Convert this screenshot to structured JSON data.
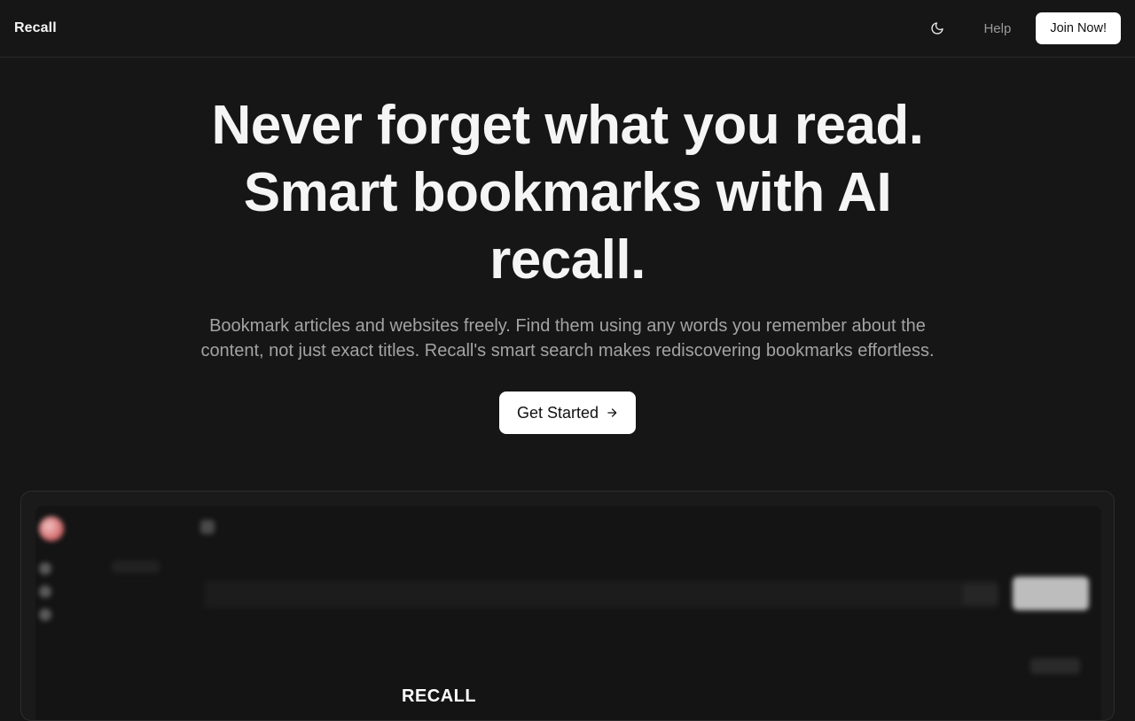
{
  "navbar": {
    "brand": "Recall",
    "theme_toggle_icon": "moon-icon",
    "help_label": "Help",
    "join_label": "Join Now!"
  },
  "hero": {
    "title_lines": [
      "Never forget what you read.",
      "Smart bookmarks with AI",
      "recall."
    ],
    "subtitle_lines": [
      "Bookmark articles and websites freely. Find them using any words you remember about the",
      "content, not just exact titles. Recall's smart search makes rediscovering bookmarks effortless."
    ],
    "cta_label": "Get Started",
    "cta_icon": "arrow-right-icon"
  },
  "preview": {
    "card_logo_text": "RECALL"
  },
  "colors": {
    "background": "#161616",
    "text_primary": "#f5f5f5",
    "text_muted": "#a3a3a3",
    "button_bg": "#ffffff",
    "button_text": "#111111",
    "border": "#2a2a2a"
  }
}
